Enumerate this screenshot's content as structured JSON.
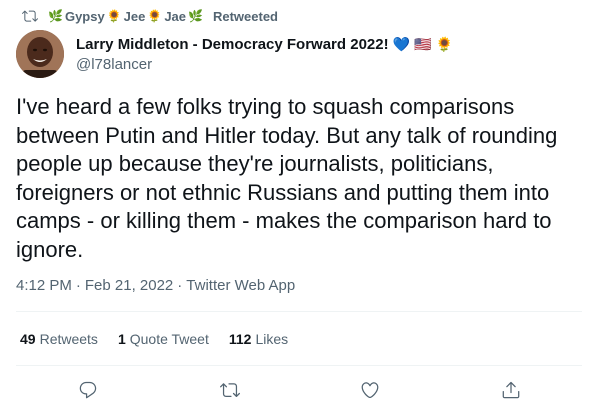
{
  "retweet_header": {
    "icon": "retweet-icon",
    "names": [
      "Gypsy",
      "Jee",
      "Jae"
    ],
    "emojis": [
      "🌿",
      "🌻",
      "🌻",
      "🌿"
    ],
    "label": "Retweeted"
  },
  "author": {
    "display_name": "Larry Middleton - Democracy Forward 2022!",
    "name_emojis": [
      "💙",
      "🇺🇸",
      "🌻"
    ],
    "handle": "@l78lancer"
  },
  "tweet": {
    "text": "I've heard a few folks trying to squash comparisons between Putin and Hitler today. But any talk of rounding people up because they're journalists, politicians, foreigners or not ethnic Russians and putting them into camps - or killing them - makes the comparison hard to ignore.",
    "time": "4:12 PM",
    "date": "Feb 21, 2022",
    "app": "Twitter Web App"
  },
  "stats": {
    "retweets_count": "49",
    "retweets_label": "Retweets",
    "quotes_count": "1",
    "quotes_label": "Quote Tweet",
    "likes_count": "112",
    "likes_label": "Likes"
  },
  "actions": [
    "reply-icon",
    "retweet-icon",
    "like-icon",
    "share-icon"
  ],
  "colors": {
    "text_primary": "#0f1419",
    "text_secondary": "#536471",
    "divider": "#eff3f4"
  }
}
